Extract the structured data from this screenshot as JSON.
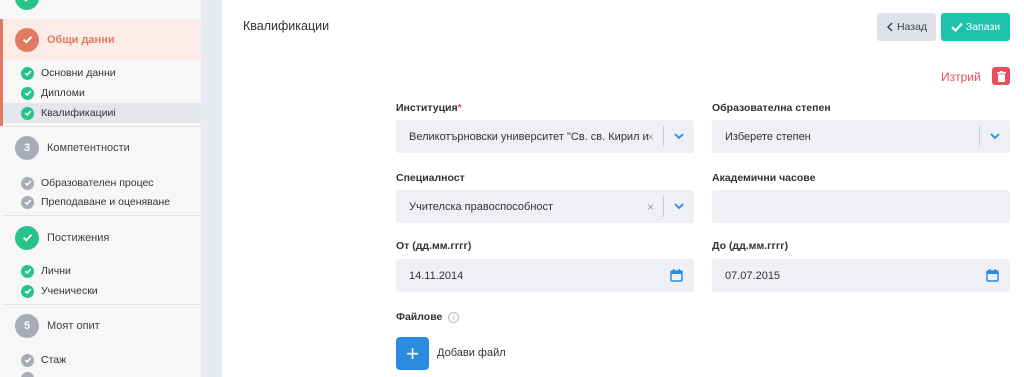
{
  "sidebar": {
    "steps": [
      {
        "label": "Общи данни",
        "state": "done"
      },
      {
        "label": "Компетентности",
        "number": "3",
        "state": "pending"
      },
      {
        "label": "Постижения",
        "state": "done"
      },
      {
        "label": "Моят опит",
        "number": "5",
        "state": "pending"
      }
    ],
    "subitems": {
      "general": [
        "Основни данни",
        "Дипломи",
        "Квалификацииi"
      ],
      "competences": [
        "Образователен процес",
        "Преподаване и оценяване"
      ],
      "achievements": [
        "Лични",
        "Ученически"
      ],
      "experience": [
        "Стаж"
      ]
    }
  },
  "header": {
    "title": "Квалификации",
    "back_label": "Назад",
    "save_label": "Запази"
  },
  "form": {
    "delete_label": "Изтрий",
    "institution": {
      "label": "Институция",
      "required_mark": "*",
      "value": "Великотърновски университет \"Св. св. Кирил и"
    },
    "degree": {
      "label": "Образователна степен",
      "placeholder": "Изберете степен"
    },
    "specialty": {
      "label": "Специалност",
      "value": "Учителска правоспособност"
    },
    "academic_hours": {
      "label": "Академични часове",
      "value": ""
    },
    "from": {
      "label": "От (дд.мм.гггг)",
      "value": "14.11.2014"
    },
    "to": {
      "label": "До (дд.мм.гггг)",
      "value": "07.07.2015"
    },
    "files": {
      "label": "Файлове",
      "info_glyph": "i",
      "add_label": "Добави файл",
      "add_glyph": "+"
    },
    "clear_glyph": "×"
  },
  "colors": {
    "done": "#27c38a",
    "active_step": "#e07a63",
    "pending": "#a7acb6",
    "accent": "#1cc4ad",
    "danger": "#e94e5d",
    "link": "#2c8be0"
  }
}
